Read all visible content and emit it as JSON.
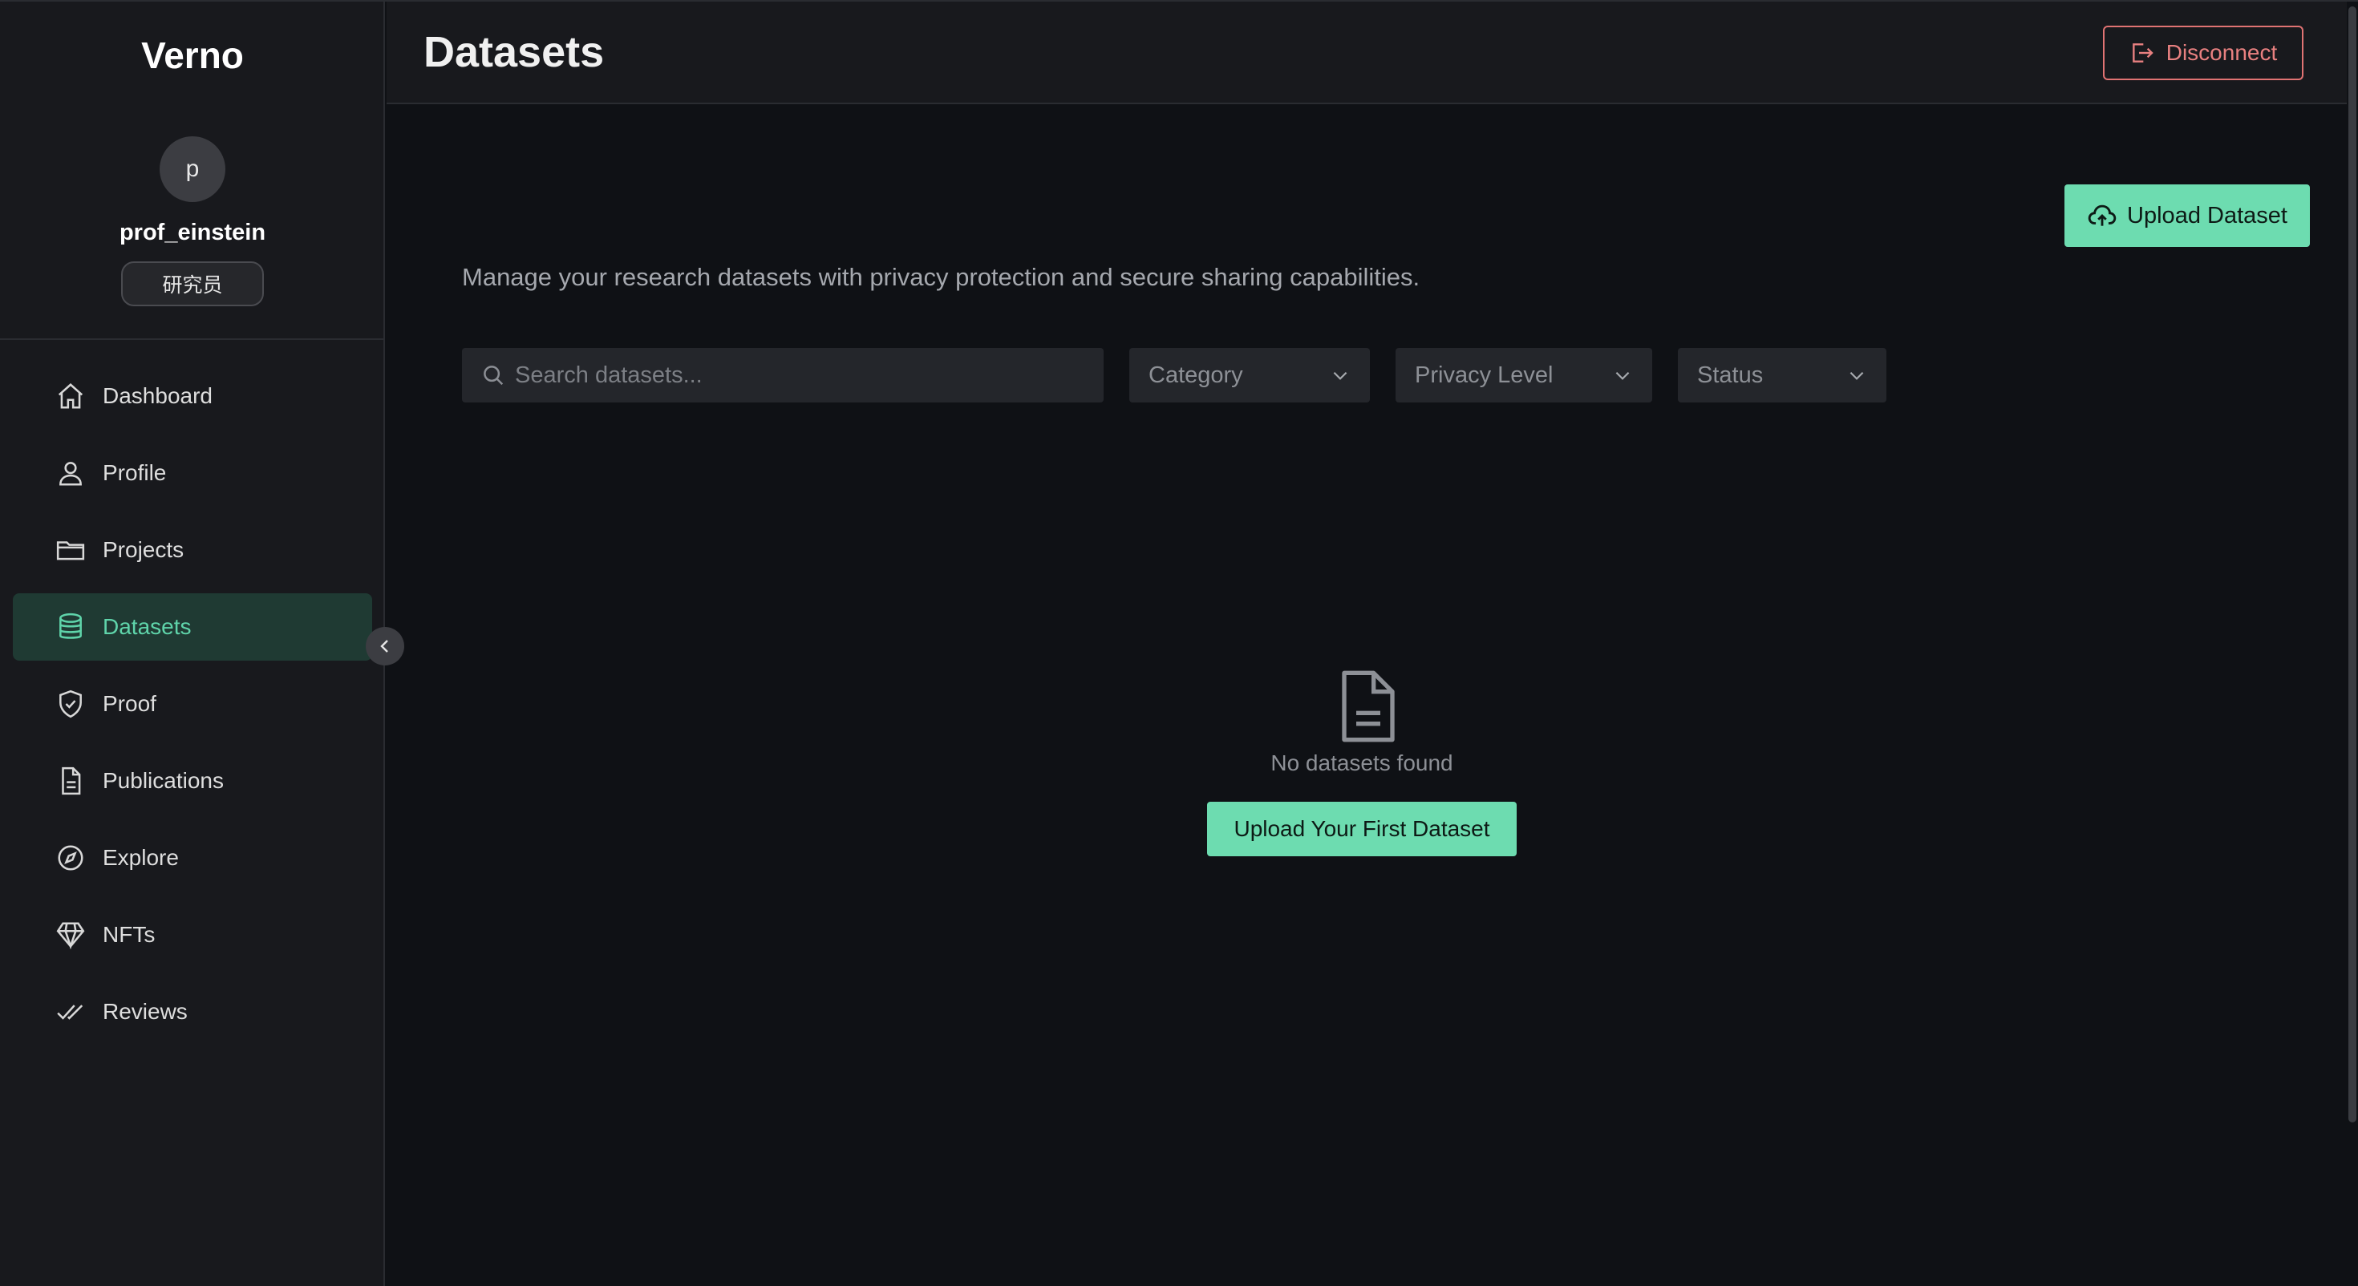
{
  "app": {
    "brand": "Verno"
  },
  "user": {
    "avatar_letter": "p",
    "username": "prof_einstein",
    "role": "研究员"
  },
  "sidebar": {
    "items": [
      {
        "label": "Dashboard",
        "icon": "home-icon",
        "active": false
      },
      {
        "label": "Profile",
        "icon": "user-icon",
        "active": false
      },
      {
        "label": "Projects",
        "icon": "folder-icon",
        "active": false
      },
      {
        "label": "Datasets",
        "icon": "database-icon",
        "active": true
      },
      {
        "label": "Proof",
        "icon": "shield-check-icon",
        "active": false
      },
      {
        "label": "Publications",
        "icon": "document-icon",
        "active": false
      },
      {
        "label": "Explore",
        "icon": "compass-icon",
        "active": false
      },
      {
        "label": "NFTs",
        "icon": "diamond-icon",
        "active": false
      },
      {
        "label": "Reviews",
        "icon": "double-check-icon",
        "active": false
      }
    ],
    "collapse_icon": "chevron-left-icon"
  },
  "header": {
    "title": "Datasets",
    "disconnect_label": "Disconnect"
  },
  "main": {
    "upload_label": "Upload Dataset",
    "description": "Manage your research datasets with privacy protection and secure sharing capabilities.",
    "search_placeholder": "Search datasets...",
    "filters": {
      "category": "Category",
      "privacy": "Privacy Level",
      "status": "Status"
    },
    "empty_text": "No datasets found",
    "first_upload_label": "Upload Your First Dataset"
  },
  "colors": {
    "accent": "#6ddcb0",
    "active_nav_bg": "#1f3a33",
    "danger": "#e07373",
    "background": "#0f1115",
    "sidebar_bg": "#18191d"
  }
}
